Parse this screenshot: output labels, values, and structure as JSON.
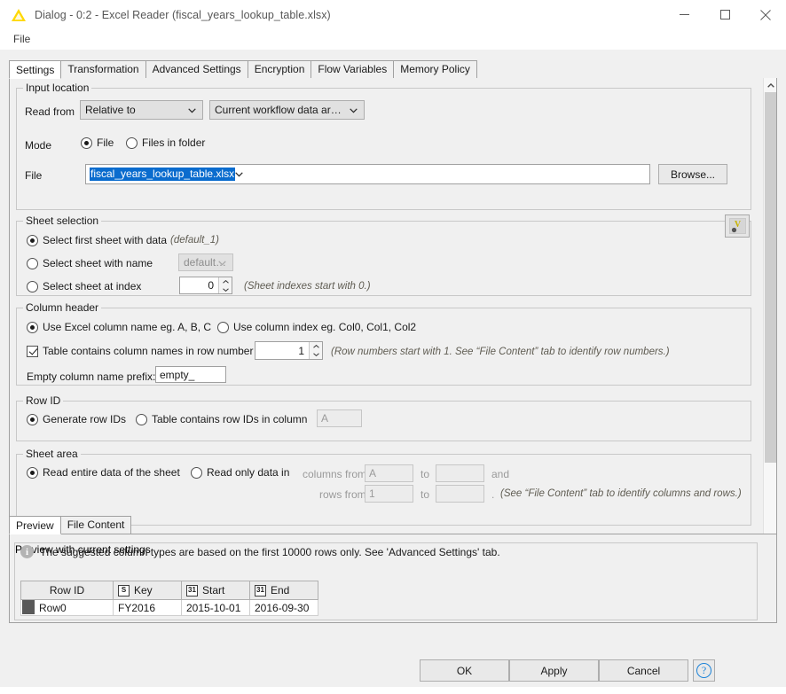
{
  "window": {
    "title": "Dialog - 0:2 - Excel Reader (fiscal_years_lookup_table.xlsx)",
    "logo_icon": "knime-triangle-icon",
    "minimize_icon": "minimize-icon",
    "maximize_icon": "maximize-icon",
    "close_icon": "close-icon",
    "accent_yellow": "#ffd800"
  },
  "menubar": {
    "file": "File"
  },
  "tabs": [
    {
      "label": "Settings",
      "active": true
    },
    {
      "label": "Transformation",
      "active": false
    },
    {
      "label": "Advanced Settings",
      "active": false
    },
    {
      "label": "Encryption",
      "active": false
    },
    {
      "label": "Flow Variables",
      "active": false
    },
    {
      "label": "Memory Policy",
      "active": false
    }
  ],
  "input_location": {
    "group_label": "Input location",
    "read_from_label": "Read from",
    "read_from_value": "Relative to",
    "read_from_target_value": "Current workflow data ar…",
    "mode_label": "Mode",
    "mode_file": "File",
    "mode_files_in_folder": "Files in folder",
    "mode_selected": "File",
    "file_label": "File",
    "file_value": "fiscal_years_lookup_table.xlsx",
    "file_value_selected": true,
    "browse_label": "Browse...",
    "flow_variable_button": "flow-variable-icon"
  },
  "sheet_selection": {
    "group_label": "Sheet selection",
    "option_first": "Select first sheet with data",
    "option_first_hint": "(default_1)",
    "option_name": "Select sheet with name",
    "option_name_value": "default…",
    "option_index": "Select sheet at index",
    "option_index_value": "0",
    "option_index_hint": "(Sheet indexes start with 0.)",
    "selected": "Select first sheet with data"
  },
  "column_header": {
    "group_label": "Column header",
    "option_excel_name": "Use Excel column name eg. A, B, C",
    "option_col_index": "Use column index eg. Col0, Col1, Col2",
    "selected": "Use Excel column name eg. A, B, C",
    "checkbox_label": "Table contains column names in row number",
    "checkbox_checked": true,
    "row_number_value": "1",
    "row_number_hint": "(Row numbers start with 1. See “File Content” tab to identify row numbers.)",
    "empty_prefix_label": "Empty column name prefix:",
    "empty_prefix_value": "empty_"
  },
  "row_id": {
    "group_label": "Row ID",
    "option_generate": "Generate row IDs",
    "option_contains": "Table contains row IDs in column",
    "selected": "Generate row IDs",
    "column_value": "A"
  },
  "sheet_area": {
    "group_label": "Sheet area",
    "option_entire": "Read entire data of the sheet",
    "option_only": "Read only data in",
    "selected": "Read entire data of the sheet",
    "columns_from_label": "columns from",
    "columns_from_value": "A",
    "columns_to_label": "to",
    "columns_to_value": "",
    "and_label": "and",
    "rows_from_label": "rows from",
    "rows_from_value": "1",
    "rows_to_label": "to",
    "rows_to_value": "",
    "period_label": ".",
    "hint": "(See “File Content” tab to identify columns and rows.)"
  },
  "preview": {
    "tabs": [
      {
        "label": "Preview",
        "active": true
      },
      {
        "label": "File Content",
        "active": false
      }
    ],
    "group_label": "Preview with current settings",
    "info_icon": "info-icon",
    "info_text": "The suggested column types are based on the first 10000 rows only. See 'Advanced Settings' tab.",
    "table": {
      "columns": [
        {
          "label": "Row ID",
          "type_icon": ""
        },
        {
          "label": "Key",
          "type_icon": "S"
        },
        {
          "label": "Start",
          "type_icon": "31"
        },
        {
          "label": "End",
          "type_icon": "31"
        }
      ],
      "rows": [
        [
          "Row0",
          "FY2016",
          "2015-10-01",
          "2016-09-30"
        ]
      ]
    }
  },
  "footer": {
    "ok": "OK",
    "apply": "Apply",
    "cancel": "Cancel",
    "help_icon": "help-icon",
    "help_glyph": "?"
  },
  "scrollbar": {
    "up_icon": "chevron-up-icon",
    "down_icon": "chevron-down-icon"
  }
}
